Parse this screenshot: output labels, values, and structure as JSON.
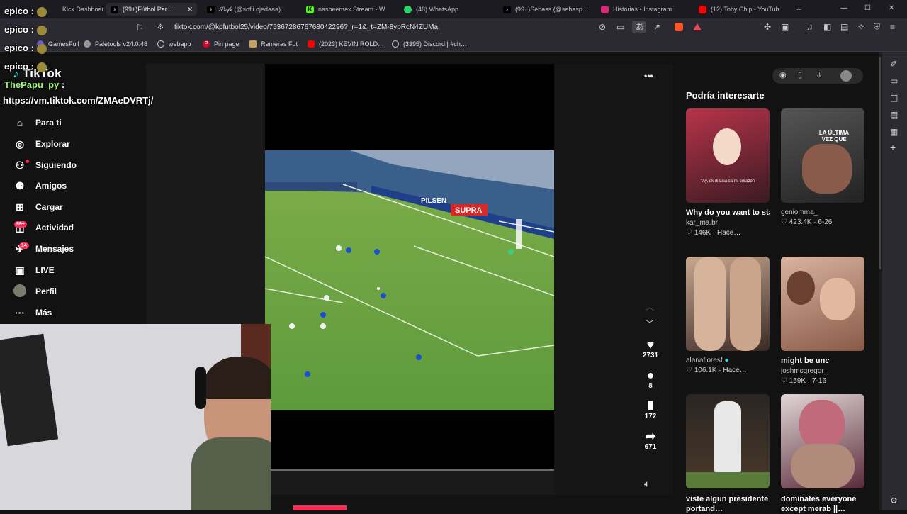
{
  "browser": {
    "tabs": [
      {
        "icon": "kick-icon",
        "label": "Kick Dashboard"
      },
      {
        "icon": "tiktok-icon",
        "label": "(99+)Fútbol Par…"
      },
      {
        "icon": "tiktok-icon",
        "label": "𝓢𝓸𝓯𝓲 (@sofii.ojedaaa) |"
      },
      {
        "icon": "kick-icon",
        "label": "nasheemax Stream - W"
      },
      {
        "icon": "whatsapp-icon",
        "label": "(48) WhatsApp"
      },
      {
        "icon": "tiktok-icon",
        "label": "(99+)Sebass (@sebasp…"
      },
      {
        "icon": "instagram-icon",
        "label": "Historias • Instagram"
      },
      {
        "icon": "youtube-icon",
        "label": "(12) Toby Chip - YouTub"
      }
    ],
    "close_glyph": "✕",
    "new_tab_glyph": "+",
    "url": "tiktok.com/@kpfutbol25/video/7536728676768042296?_r=1&_t=ZM-8ypRcN4ZUMa",
    "bookmarks": [
      {
        "icon": "games-icon",
        "label": "GamesFull"
      },
      {
        "icon": "paletools-icon",
        "label": "Paletools v24.0.48"
      },
      {
        "icon": "globe-icon",
        "label": "webapp"
      },
      {
        "icon": "pinterest-icon",
        "label": "Pin page"
      },
      {
        "icon": "remeras-icon",
        "label": "Remeras Fut"
      },
      {
        "icon": "youtube-icon",
        "label": "(2023) KEVIN ROLD…"
      },
      {
        "icon": "discord-icon",
        "label": "(3395) Discord | #ch…"
      }
    ]
  },
  "stream_overlay": {
    "chat": [
      {
        "user": "epico",
        "sep": ":"
      },
      {
        "user": "epico",
        "sep": ":"
      },
      {
        "user": "epico",
        "sep": ":"
      },
      {
        "user": "epico",
        "sep": ":"
      },
      {
        "user": "ThePapu_py",
        "sep": ":"
      }
    ],
    "link": "https://vm.tiktok.com/ZMAeDVRTj/"
  },
  "tiktok": {
    "logo": "TikTok",
    "nav": [
      {
        "icon": "home-icon",
        "label": "Para ti"
      },
      {
        "icon": "compass-icon",
        "label": "Explorar"
      },
      {
        "icon": "following-icon",
        "label": "Siguiendo"
      },
      {
        "icon": "friends-icon",
        "label": "Amigos"
      },
      {
        "icon": "upload-icon",
        "label": "Cargar"
      },
      {
        "icon": "activity-icon",
        "label": "Actividad",
        "badge": "99+"
      },
      {
        "icon": "messages-icon",
        "label": "Mensajes",
        "badge": "14"
      },
      {
        "icon": "live-icon",
        "label": "LIVE"
      },
      {
        "icon": "avatar",
        "label": "Perfil"
      },
      {
        "icon": "more-icon",
        "label": "Más"
      }
    ],
    "video_ads": [
      "PILSEN",
      "SUPRA"
    ],
    "actions": {
      "likes": "2731",
      "comments": "8",
      "saves": "172",
      "shares": "671"
    },
    "more_glyph": "•••",
    "suggest_heading": "Podría interesarte",
    "suggestions": [
      {
        "title": "Why do you want to stay FIVE NIGHTS A…",
        "user": "kar_ma.br",
        "likes": "146K",
        "date": "Hace…",
        "colors": [
          "#5a2a2e",
          "#b23a4a"
        ],
        "overlay": "\"Ay, ok di Lisa sa mi corazón"
      },
      {
        "title": "",
        "user": "geniomma_",
        "likes": "423.4K",
        "date": "6-26",
        "colors": [
          "#3a3a3a",
          "#8a6a5a"
        ],
        "overlay": "LA ÚLTIMA VEZ QUE"
      },
      {
        "title": "",
        "user": "alanafloresf",
        "likes": "106.1K",
        "date": "Hace…",
        "colors": [
          "#4a3a35",
          "#8a6a5e"
        ],
        "overlay": ""
      },
      {
        "title": "might be unc",
        "user": "joshmcgregor_",
        "likes": "159K",
        "date": "7-16",
        "colors": [
          "#6a5a50",
          "#c9b2a0"
        ],
        "overlay": ""
      },
      {
        "title": "viste algun presidente portand…",
        "user": "",
        "likes": "",
        "date": "",
        "colors": [
          "#2a2522",
          "#6b5a4a"
        ],
        "overlay": ""
      },
      {
        "title": "dominates everyone except merab ||…",
        "user": "",
        "likes": "",
        "date": "",
        "colors": [
          "#2a2030",
          "#7a3a5a"
        ],
        "overlay": ""
      }
    ],
    "colors": {
      "accent": "#fe2c55",
      "sidebar_bg": "#121212",
      "player_bg": "#0f0f0f"
    }
  }
}
